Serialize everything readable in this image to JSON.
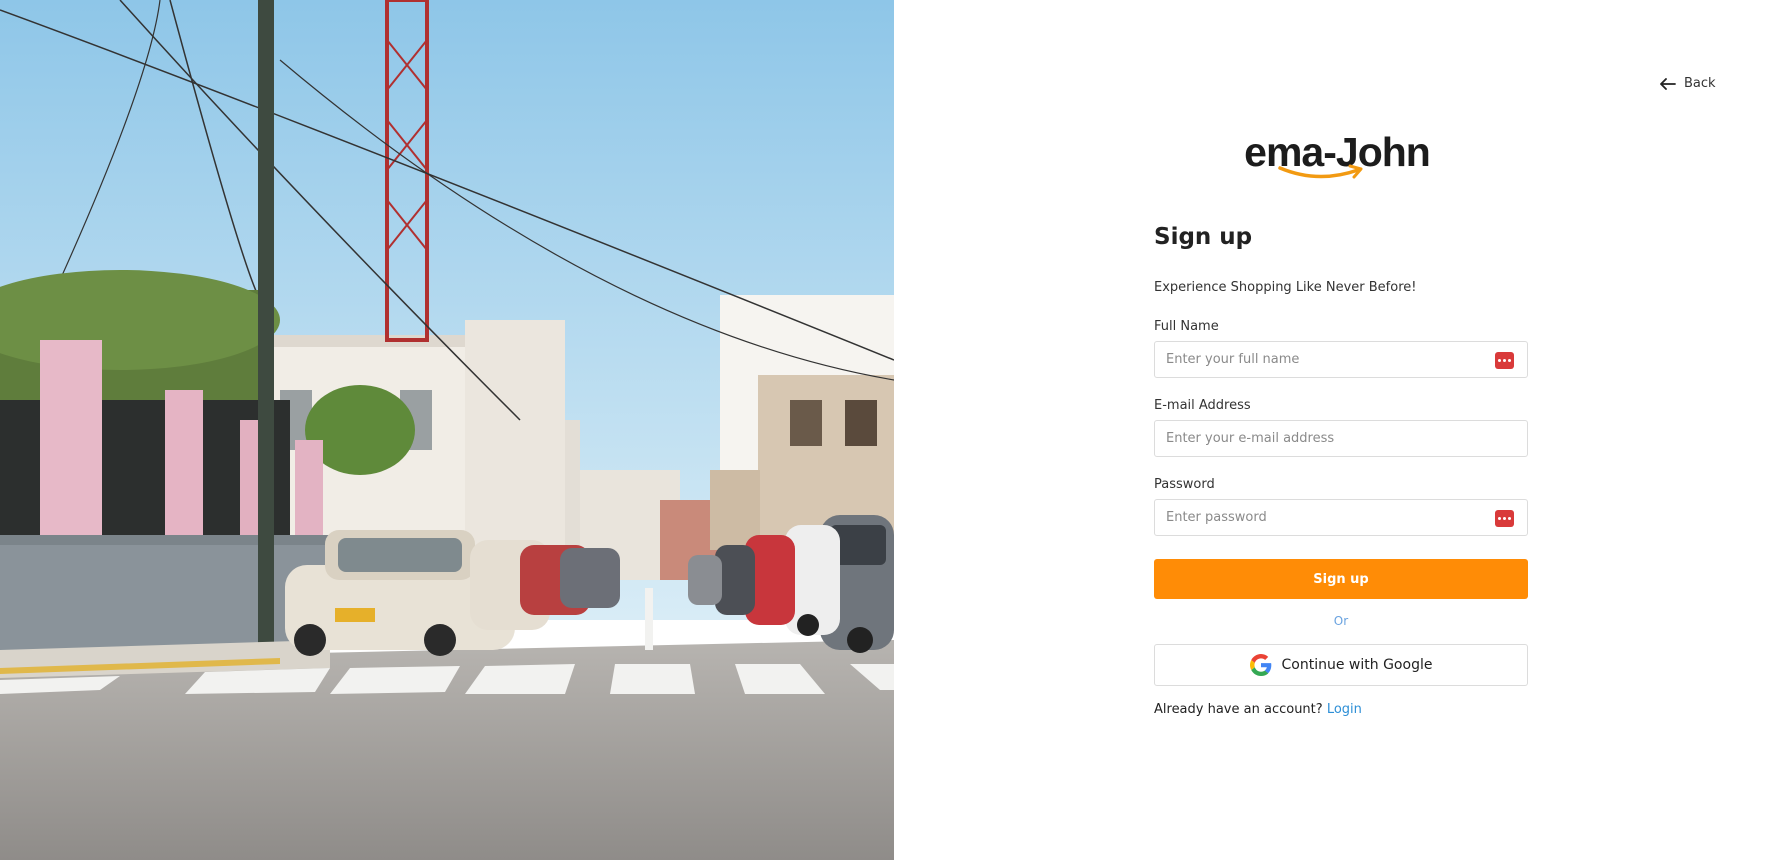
{
  "back": {
    "label": "Back"
  },
  "logo": {
    "text": "ema-John"
  },
  "form": {
    "title": "Sign up",
    "subtitle": "Experience Shopping Like Never Before!",
    "fields": [
      {
        "label": "Full Name",
        "placeholder": "Enter your full name",
        "value": "",
        "has_password_manager_icon": true
      },
      {
        "label": "E-mail Address",
        "placeholder": "Enter your e-mail address",
        "value": "",
        "has_password_manager_icon": false
      },
      {
        "label": "Password",
        "placeholder": "Enter password",
        "value": "",
        "has_password_manager_icon": true
      }
    ],
    "submit_label": "Sign up",
    "divider_label": "Or",
    "google_label": "Continue with Google",
    "login_prompt": "Already have an account?",
    "login_link": "Login"
  },
  "colors": {
    "accent": "#ff8c06",
    "link": "#2e8fd6",
    "divider_text": "#6aa3e0",
    "password_manager_icon": "#d93a3a"
  },
  "icons": {
    "back": "arrow-left-icon",
    "logo_smile": "amazon-smile-arrow-icon",
    "password_manager": "password-manager-icon",
    "google": "google-g-icon"
  }
}
